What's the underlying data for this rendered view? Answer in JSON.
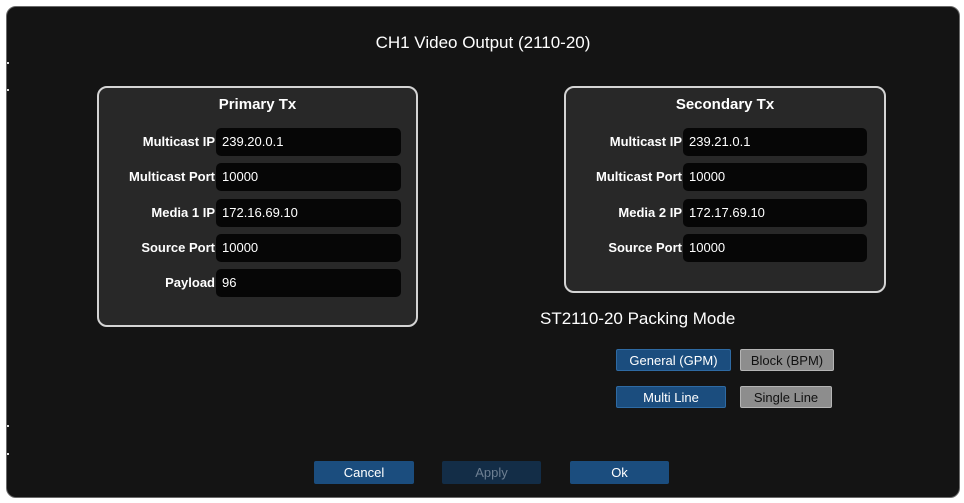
{
  "dialog": {
    "title": "CH1 Video Output (2110-20)"
  },
  "primary": {
    "title": "Primary Tx",
    "fields": [
      {
        "label": "Multicast IP",
        "value": "239.20.0.1"
      },
      {
        "label": "Multicast Port",
        "value": "10000"
      },
      {
        "label": "Media 1 IP",
        "value": "172.16.69.10"
      },
      {
        "label": "Source Port",
        "value": "10000"
      },
      {
        "label": "Payload",
        "value": "96"
      }
    ]
  },
  "secondary": {
    "title": "Secondary Tx",
    "fields": [
      {
        "label": "Multicast IP",
        "value": "239.21.0.1"
      },
      {
        "label": "Multicast Port",
        "value": "10000"
      },
      {
        "label": "Media 2 IP",
        "value": "172.17.69.10"
      },
      {
        "label": "Source Port",
        "value": "10000"
      }
    ]
  },
  "packing": {
    "title": "ST2110-20 Packing Mode",
    "mode_options": [
      {
        "label": "General (GPM)",
        "selected": true
      },
      {
        "label": "Block (BPM)",
        "selected": false
      }
    ],
    "line_options": [
      {
        "label": "Multi Line",
        "selected": true
      },
      {
        "label": "Single Line",
        "selected": false
      }
    ]
  },
  "footer": {
    "cancel": "Cancel",
    "apply": "Apply",
    "ok": "Ok"
  },
  "colors": {
    "background": "#141414",
    "panel": "#282828",
    "accent": "#1b4d7e",
    "inactive": "#8d8d8d"
  }
}
